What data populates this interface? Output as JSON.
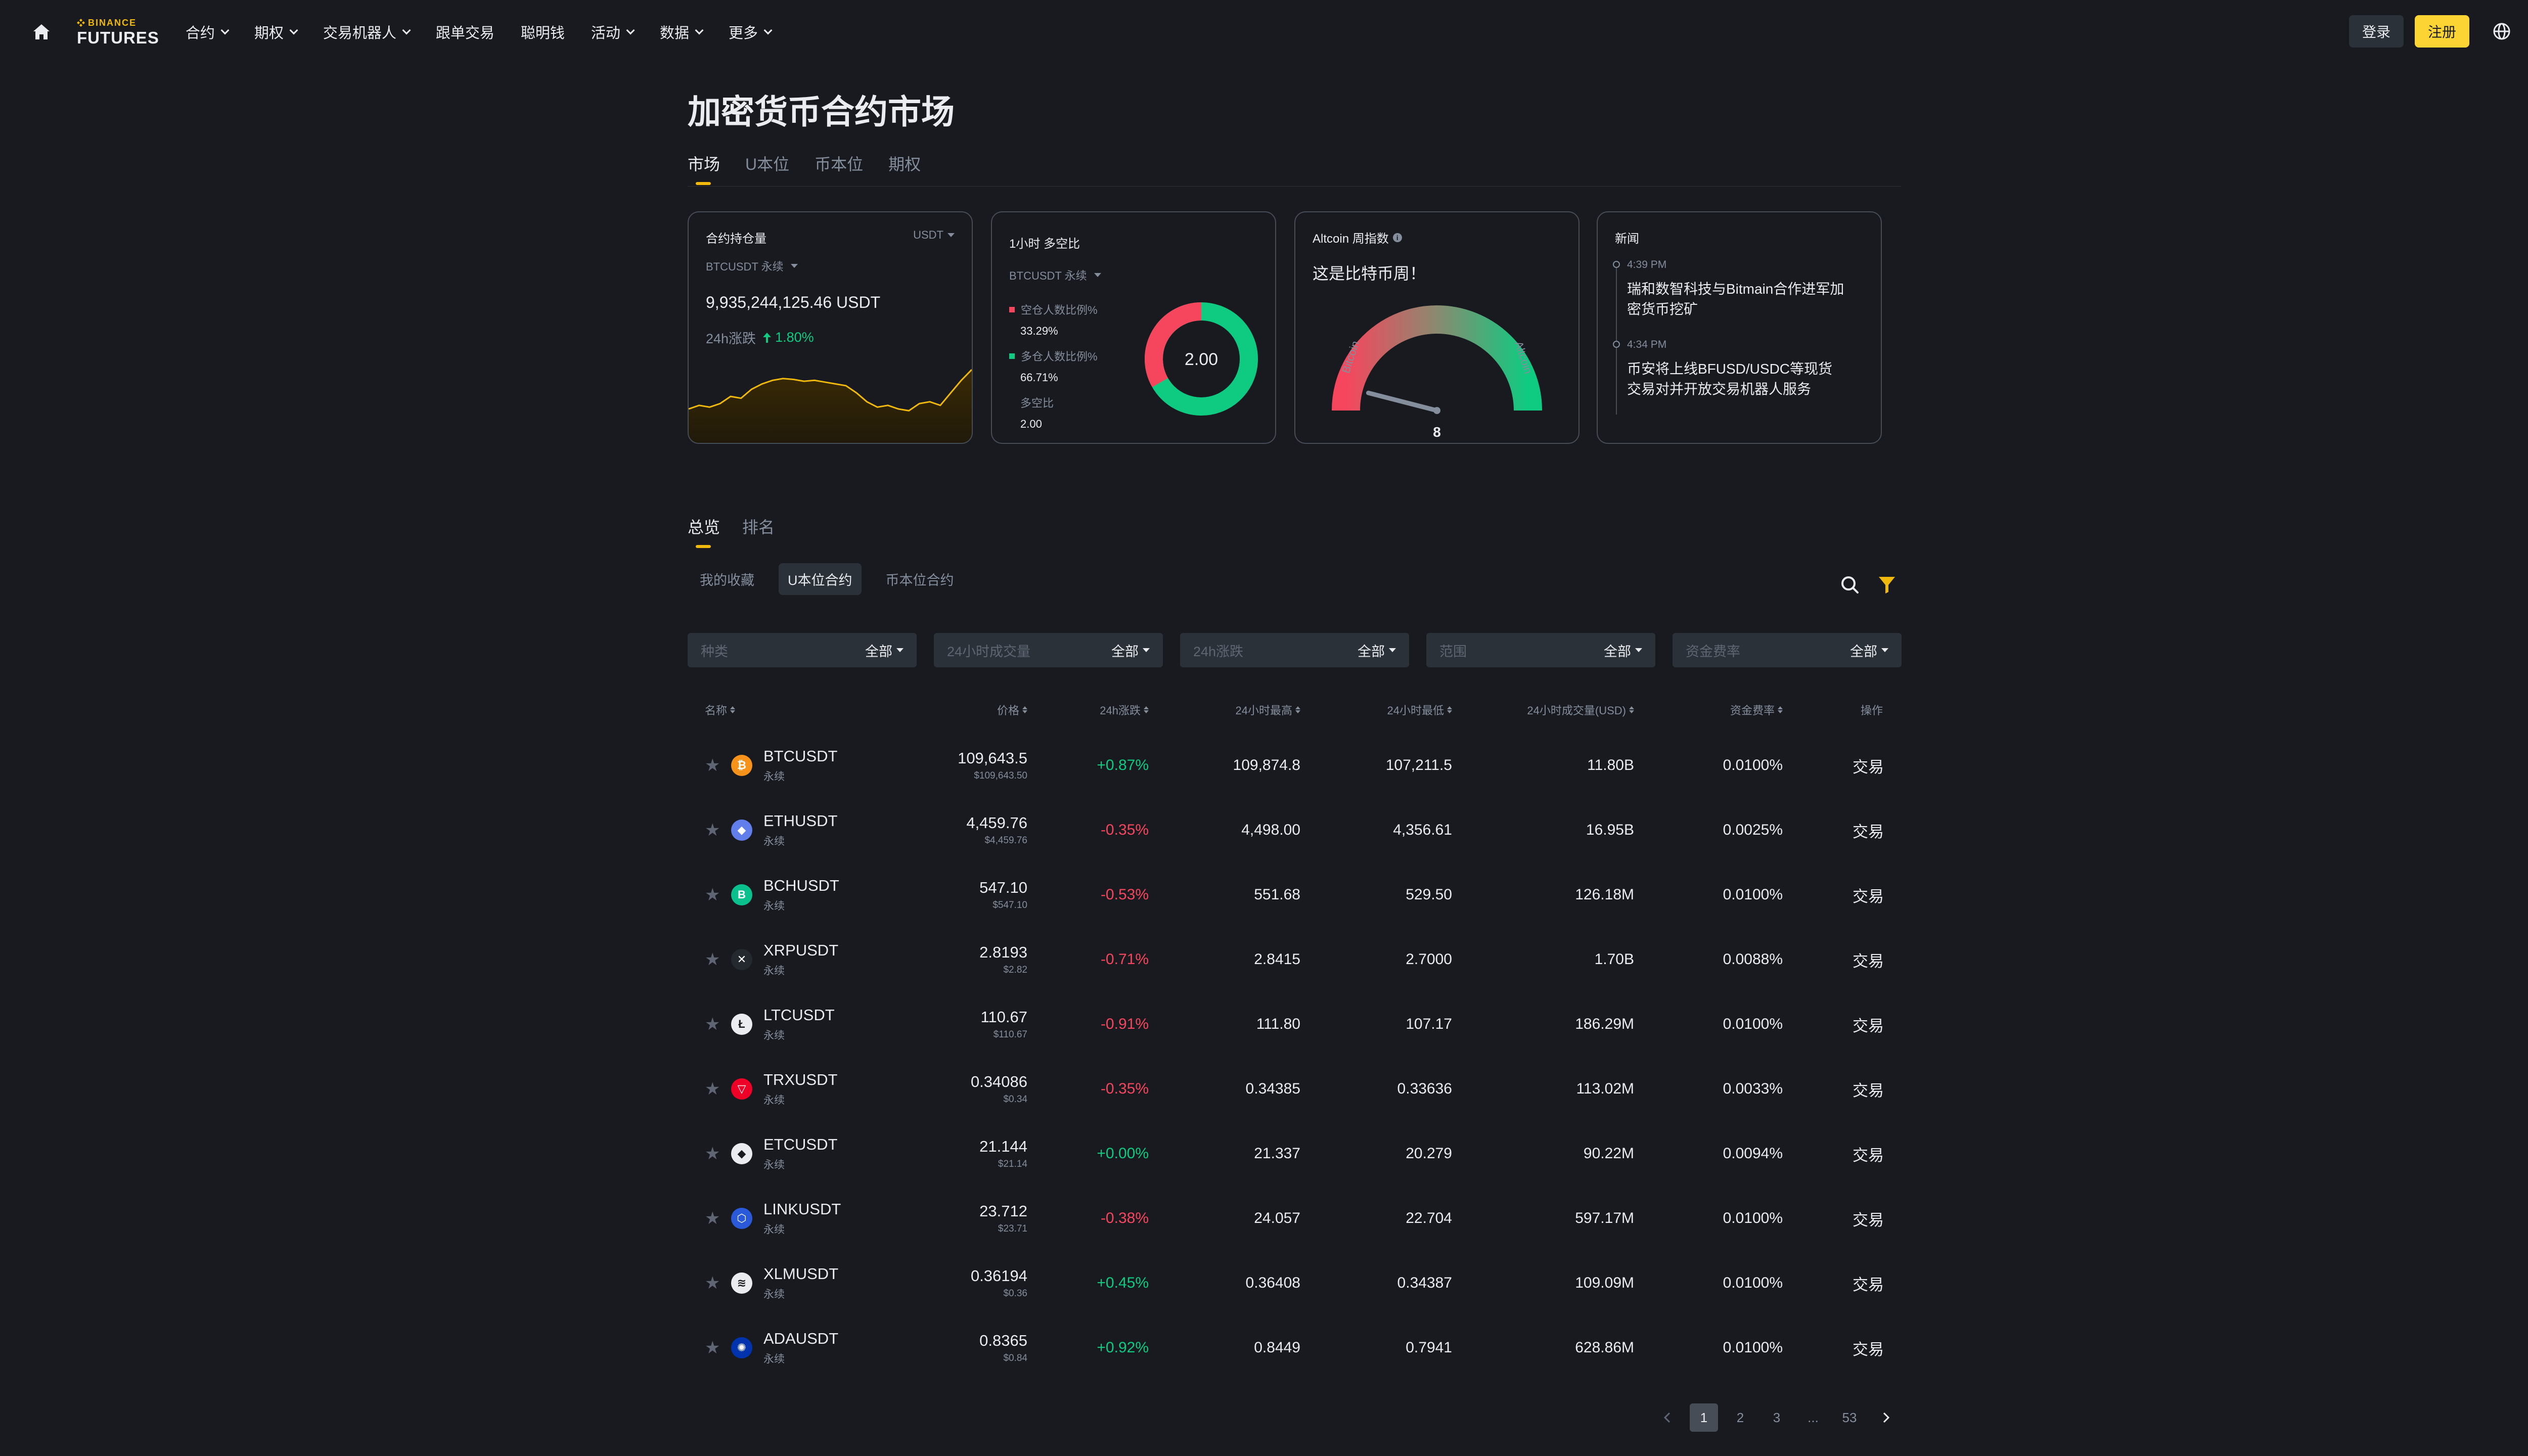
{
  "header": {
    "logo_top": "BINANCE",
    "logo_bottom": "FUTURES",
    "nav": [
      {
        "label": "合约",
        "dropdown": true
      },
      {
        "label": "期权",
        "dropdown": true
      },
      {
        "label": "交易机器人",
        "dropdown": true
      },
      {
        "label": "跟单交易",
        "dropdown": false
      },
      {
        "label": "聪明钱",
        "dropdown": false
      },
      {
        "label": "活动",
        "dropdown": true
      },
      {
        "label": "数据",
        "dropdown": true
      },
      {
        "label": "更多",
        "dropdown": true
      }
    ],
    "login": "登录",
    "register": "注册",
    "accent": "#FCD535"
  },
  "page": {
    "title": "加密货币合约市场",
    "tabs": [
      "市场",
      "U本位",
      "币本位",
      "期权"
    ]
  },
  "cards": {
    "open_interest": {
      "title": "合约持仓量",
      "unit_selector": "USDT",
      "pair": "BTCUSDT 永续",
      "value": "9,935,244,125.46 USDT",
      "change_label": "24h涨跌",
      "change_value": "1.80%",
      "sparkline": [
        0.38,
        0.42,
        0.4,
        0.44,
        0.52,
        0.5,
        0.6,
        0.66,
        0.7,
        0.72,
        0.71,
        0.69,
        0.7,
        0.68,
        0.66,
        0.64,
        0.56,
        0.46,
        0.4,
        0.42,
        0.38,
        0.36,
        0.44,
        0.46,
        0.42,
        0.56,
        0.7,
        0.82
      ]
    },
    "long_short": {
      "title": "1小时 多空比",
      "pair": "BTCUSDT 永续",
      "short_label": "空仓人数比例%",
      "short_value": "33.29%",
      "long_label": "多仓人数比例%",
      "long_value": "66.71%",
      "ratio_label": "多空比",
      "ratio_value": "2.00",
      "short_pct": 33.29,
      "long_pct": 66.71,
      "short_color": "#F6465D",
      "long_color": "#0ECB81"
    },
    "altcoin": {
      "title": "Altcoin 周指数",
      "season_text": "这是比特币周！",
      "left_label": "Bitcoin",
      "right_label": "Altcoin",
      "index_value": "8",
      "index_number": 8
    },
    "news": {
      "title": "新闻",
      "items": [
        {
          "time": "4:39 PM",
          "text": "瑞和数智科技与Bitmain合作进军加密货币挖矿"
        },
        {
          "time": "4:34 PM",
          "text": "币安将上线BFUSD/USDC等现货交易对并开放交易机器人服务"
        }
      ]
    }
  },
  "overview": {
    "tabs": [
      "总览",
      "排名"
    ],
    "sub_tabs": [
      "我的收藏",
      "U本位合约",
      "币本位合约"
    ],
    "filters": [
      {
        "label": "种类",
        "value": "全部"
      },
      {
        "label": "24小时成交量",
        "value": "全部"
      },
      {
        "label": "24h涨跌",
        "value": "全部"
      },
      {
        "label": "范围",
        "value": "全部"
      },
      {
        "label": "资金费率",
        "value": "全部"
      }
    ]
  },
  "table": {
    "headers": {
      "name": "名称",
      "price": "价格",
      "change": "24h涨跌",
      "high": "24小时最高",
      "low": "24小时最低",
      "volume": "24小时成交量(USD)",
      "funding": "资金费率",
      "action": "操作"
    },
    "rows": [
      {
        "symbol": "BTCUSDT",
        "type": "永续",
        "price": "109,643.5",
        "price_usd": "$109,643.50",
        "change": "+0.87%",
        "high": "109,874.8",
        "low": "107,211.5",
        "volume": "11.80B",
        "funding": "0.0100%",
        "action": "交易",
        "icon": "bitcoin-icon",
        "glyph": "₿",
        "color": "#F7931A",
        "dir": "pos"
      },
      {
        "symbol": "ETHUSDT",
        "type": "永续",
        "price": "4,459.76",
        "price_usd": "$4,459.76",
        "change": "-0.35%",
        "high": "4,498.00",
        "low": "4,356.61",
        "volume": "16.95B",
        "funding": "0.0025%",
        "action": "交易",
        "icon": "ethereum-icon",
        "glyph": "◆",
        "color": "#627EEA",
        "dir": "neg"
      },
      {
        "symbol": "BCHUSDT",
        "type": "永续",
        "price": "547.10",
        "price_usd": "$547.10",
        "change": "-0.53%",
        "high": "551.68",
        "low": "529.50",
        "volume": "126.18M",
        "funding": "0.0100%",
        "action": "交易",
        "icon": "bitcoin-cash-icon",
        "glyph": "B",
        "color": "#0AC18E",
        "dir": "neg"
      },
      {
        "symbol": "XRPUSDT",
        "type": "永续",
        "price": "2.8193",
        "price_usd": "$2.82",
        "change": "-0.71%",
        "high": "2.8415",
        "low": "2.7000",
        "volume": "1.70B",
        "funding": "0.0088%",
        "action": "交易",
        "icon": "xrp-icon",
        "glyph": "✕",
        "color": "#23292F",
        "dir": "neg"
      },
      {
        "symbol": "LTCUSDT",
        "type": "永续",
        "price": "110.67",
        "price_usd": "$110.67",
        "change": "-0.91%",
        "high": "111.80",
        "low": "107.17",
        "volume": "186.29M",
        "funding": "0.0100%",
        "action": "交易",
        "icon": "litecoin-icon",
        "glyph": "Ł",
        "color": "#EAECEF",
        "dir": "neg"
      },
      {
        "symbol": "TRXUSDT",
        "type": "永续",
        "price": "0.34086",
        "price_usd": "$0.34",
        "change": "-0.35%",
        "high": "0.34385",
        "low": "0.33636",
        "volume": "113.02M",
        "funding": "0.0033%",
        "action": "交易",
        "icon": "tron-icon",
        "glyph": "▽",
        "color": "#EF0027",
        "dir": "neg"
      },
      {
        "symbol": "ETCUSDT",
        "type": "永续",
        "price": "21.144",
        "price_usd": "$21.14",
        "change": "+0.00%",
        "high": "21.337",
        "low": "20.279",
        "volume": "90.22M",
        "funding": "0.0094%",
        "action": "交易",
        "icon": "ethereum-classic-icon",
        "glyph": "◆",
        "color": "#EAECEF",
        "dir": "pos"
      },
      {
        "symbol": "LINKUSDT",
        "type": "永续",
        "price": "23.712",
        "price_usd": "$23.71",
        "change": "-0.38%",
        "high": "24.057",
        "low": "22.704",
        "volume": "597.17M",
        "funding": "0.0100%",
        "action": "交易",
        "icon": "chainlink-icon",
        "glyph": "⬡",
        "color": "#2A5ADA",
        "dir": "neg"
      },
      {
        "symbol": "XLMUSDT",
        "type": "永续",
        "price": "0.36194",
        "price_usd": "$0.36",
        "change": "+0.45%",
        "high": "0.36408",
        "low": "0.34387",
        "volume": "109.09M",
        "funding": "0.0100%",
        "action": "交易",
        "icon": "stellar-icon",
        "glyph": "≋",
        "color": "#EAECEF",
        "dir": "pos"
      },
      {
        "symbol": "ADAUSDT",
        "type": "永续",
        "price": "0.8365",
        "price_usd": "$0.84",
        "change": "+0.92%",
        "high": "0.8449",
        "low": "0.7941",
        "volume": "628.86M",
        "funding": "0.0100%",
        "action": "交易",
        "icon": "cardano-icon",
        "glyph": "✺",
        "color": "#0033AD",
        "dir": "pos"
      }
    ]
  },
  "pagination": {
    "pages": [
      "1",
      "2",
      "3",
      "...",
      "53"
    ],
    "current": "1"
  }
}
